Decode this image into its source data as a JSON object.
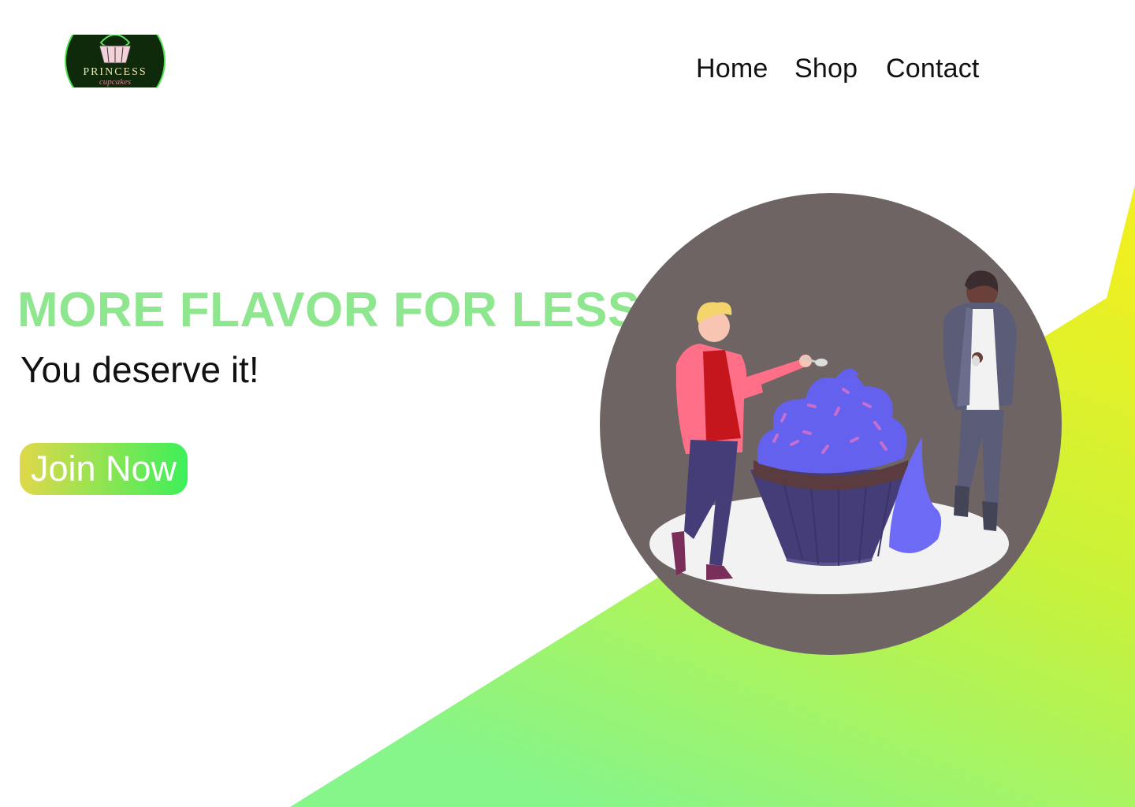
{
  "brand": {
    "name": "PRINCESS",
    "tagline": "cupcakes"
  },
  "nav": {
    "items": [
      {
        "label": "Home"
      },
      {
        "label": "Shop"
      },
      {
        "label": "Contact"
      }
    ]
  },
  "hero": {
    "title": "MORE FLAVOR FOR LESS",
    "subtitle": "You deserve it!",
    "cta_label": "Join Now"
  },
  "colors": {
    "title": "#8ee68e",
    "gradient_start": "#eef021",
    "gradient_end": "#8ef58a",
    "illustration_bg": "#6e6464",
    "cupcake_frosting": "#6461ef",
    "button_start": "#e0d84a",
    "button_end": "#3df05a"
  }
}
